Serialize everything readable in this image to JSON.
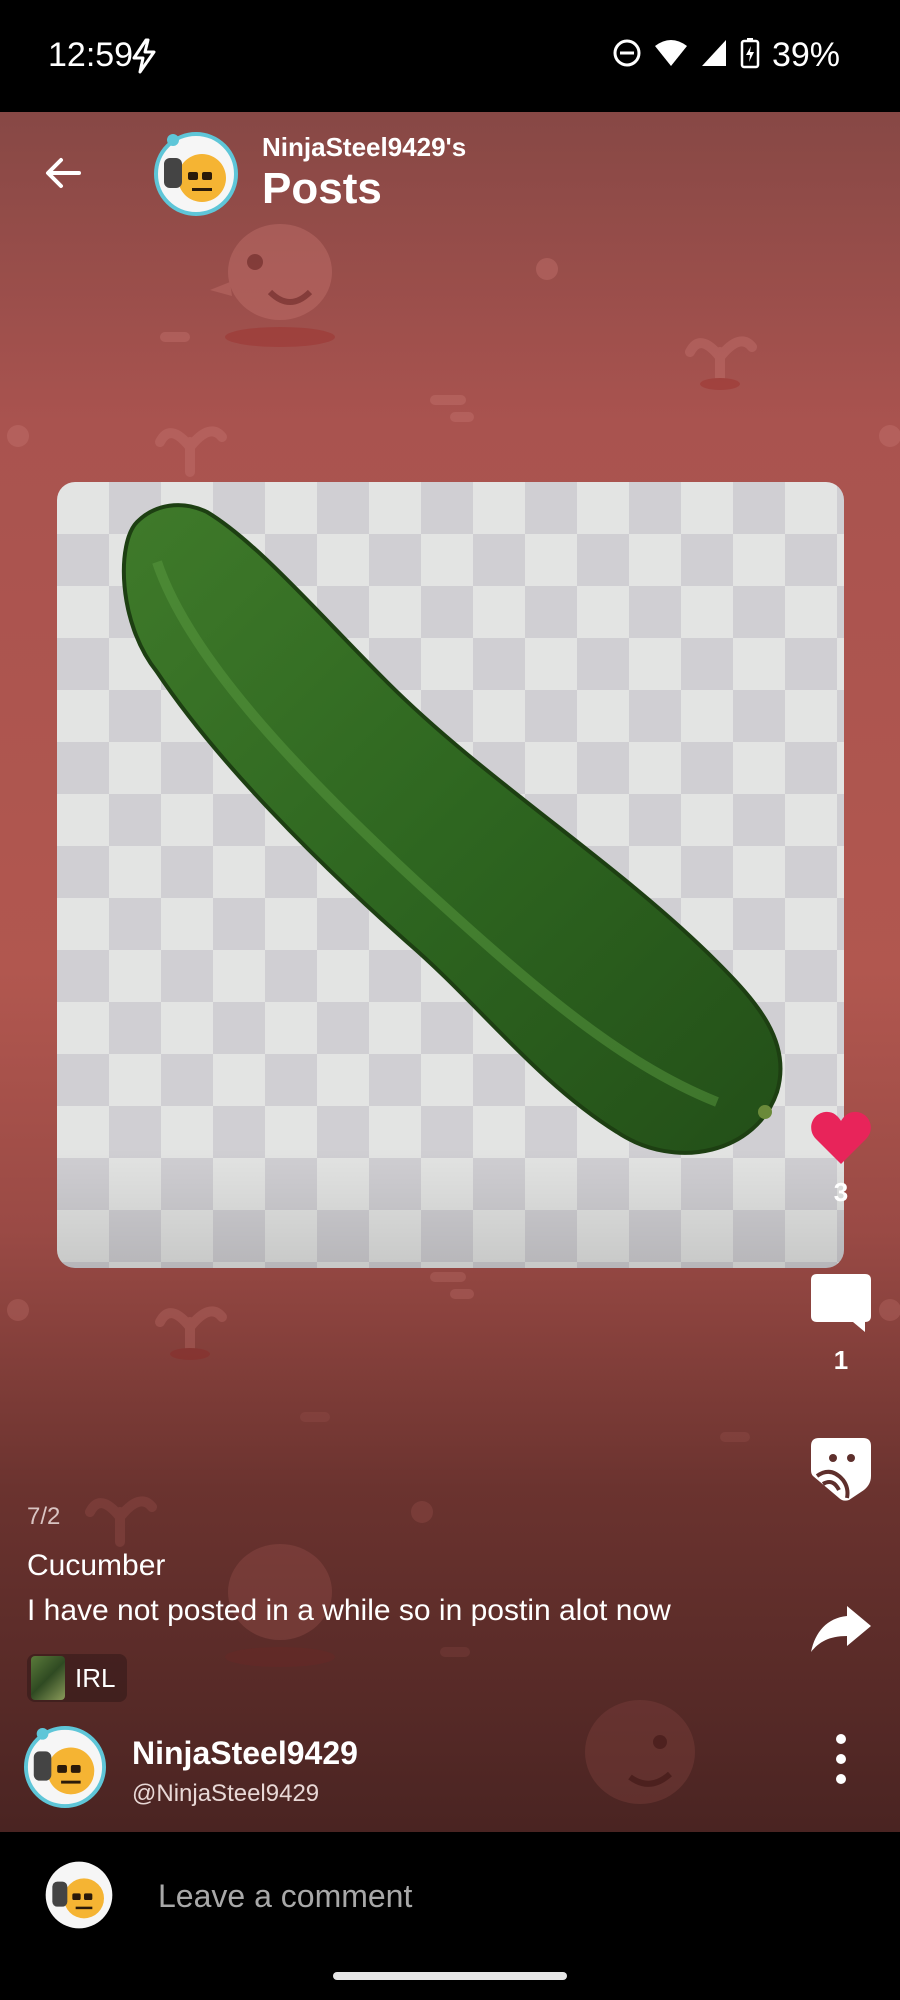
{
  "status_bar": {
    "time": "12:59",
    "battery": "39%",
    "icons": [
      "flash-icon",
      "dnd-icon",
      "wifi-icon",
      "cell-signal-icon",
      "battery-charging-icon"
    ]
  },
  "header": {
    "owner_label": "NinjaSteel9429's",
    "title": "Posts"
  },
  "post": {
    "date": "7/2",
    "title": "Cucumber",
    "body": "I have  not posted in a while so in postin alot now",
    "category": "IRL",
    "image_subject": "cucumber-image"
  },
  "actions": {
    "likes": "3",
    "comments": "1",
    "like_color": "#e8245a"
  },
  "author": {
    "name": "NinjaSteel9429",
    "handle": "@NinjaSteel9429"
  },
  "comment_bar": {
    "placeholder": "Leave a comment"
  },
  "colors": {
    "background_top": "#874845",
    "background_mid": "#b1574f",
    "background_bottom": "#4a2422"
  }
}
